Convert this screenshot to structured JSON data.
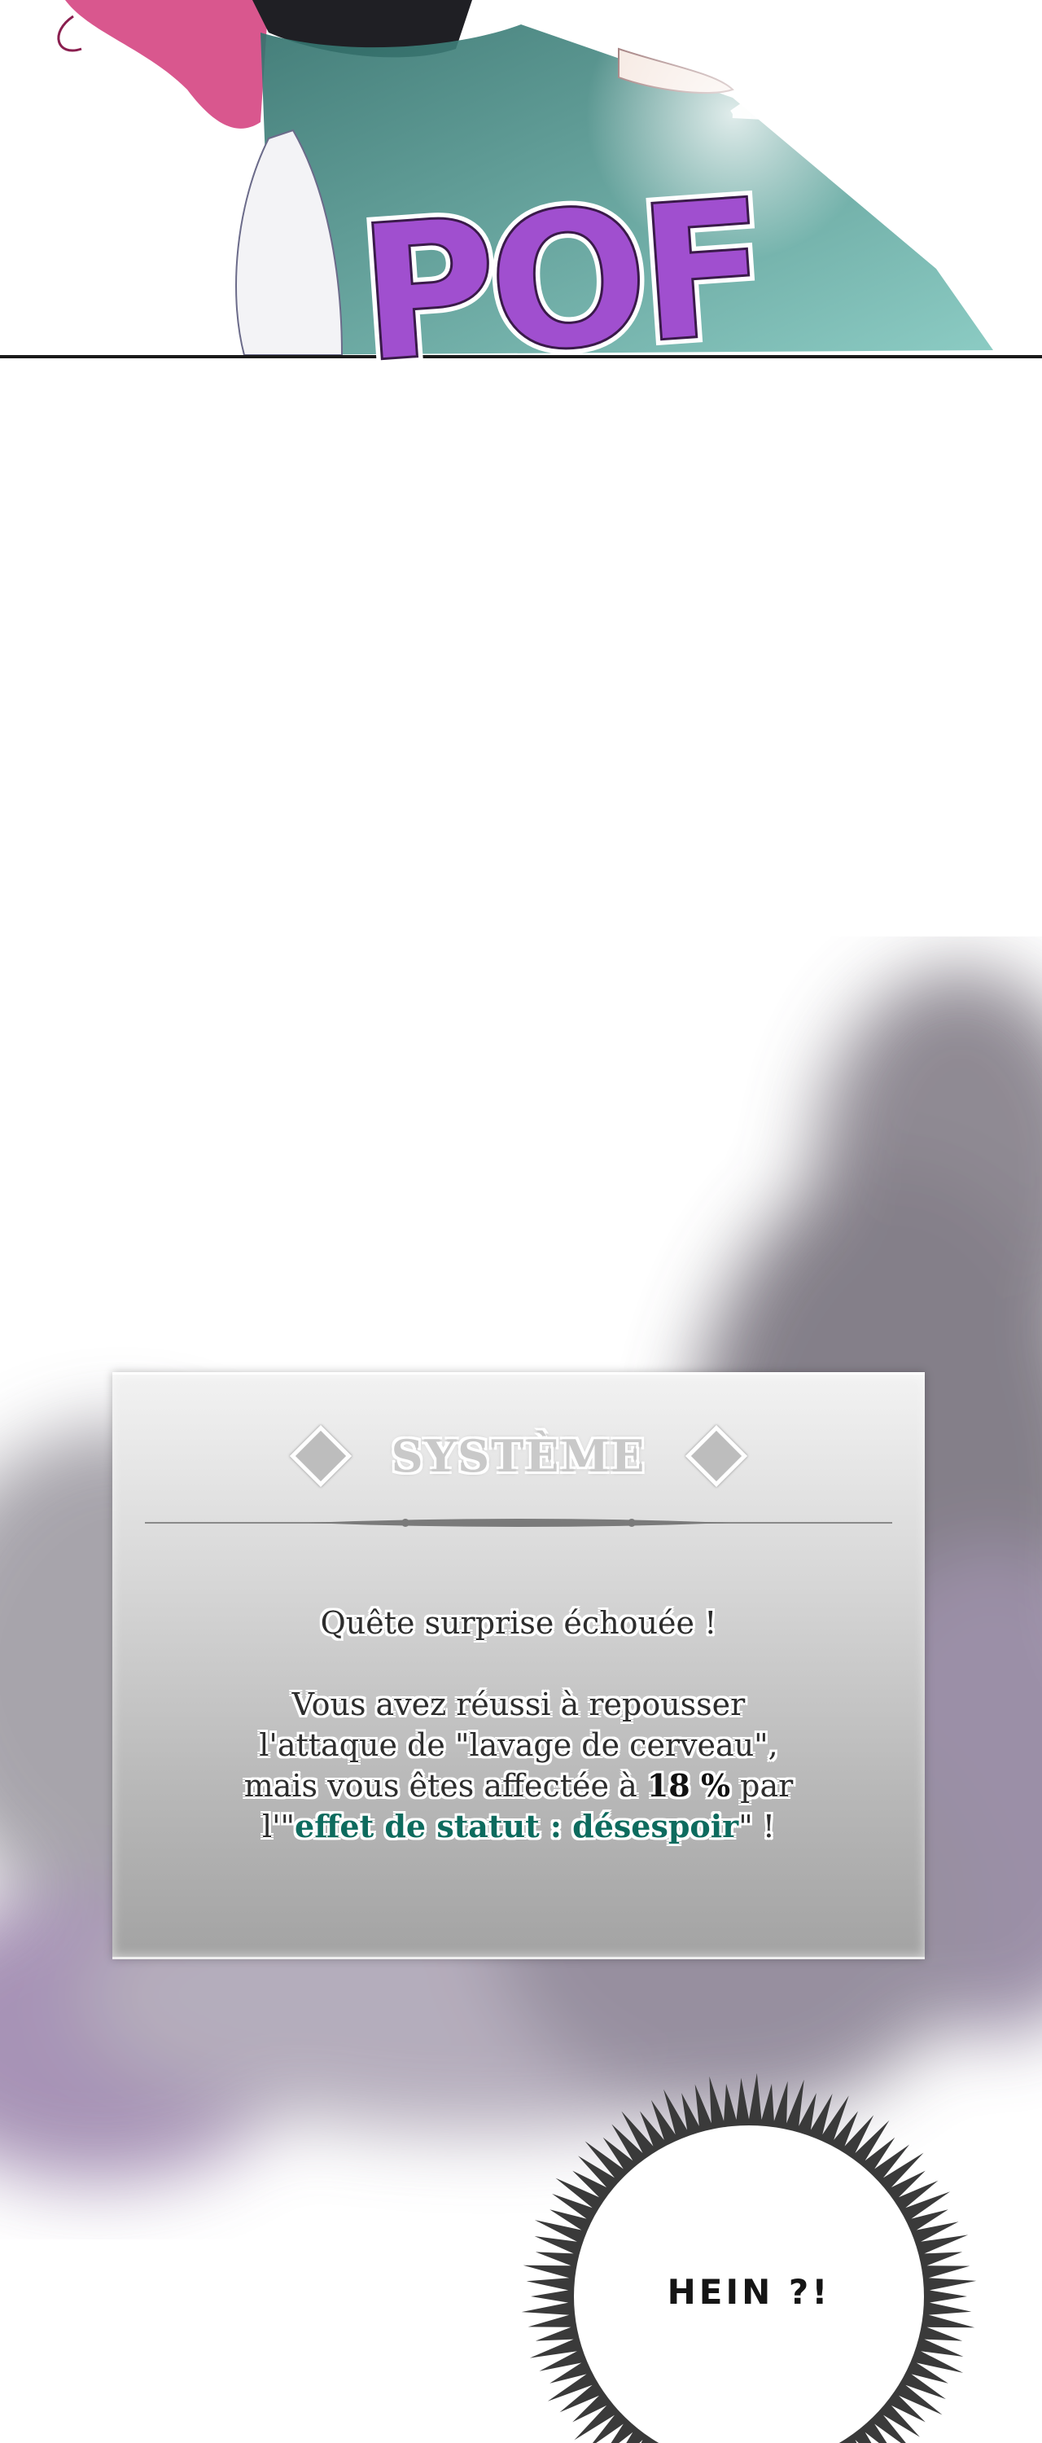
{
  "panel_top": {
    "sound_effect": "POF",
    "colors": {
      "sfx_fill": "#a04fcf",
      "sfx_dark": "#3a1a4a",
      "dress": "#4f9e95",
      "hair": "#d23a7a"
    }
  },
  "system_window": {
    "title": "SYSTÈME",
    "quest_status": "Quête surprise échouée !",
    "message": {
      "line1": "Vous avez réussi à repousser",
      "line2": "l'attaque de \"lavage de cerveau\",",
      "line3_prefix": "mais vous êtes affectée à ",
      "percentage": "18 %",
      "line3_suffix": " par",
      "line4_prefix": "l'\"",
      "status_effect": "effet de statut : désespoir",
      "line4_suffix": "\" !"
    },
    "colors": {
      "status_effect": "#0d6b5e",
      "smoke": "#6b5a78"
    }
  },
  "speech_bubble": {
    "text": "HEIN ?!"
  }
}
